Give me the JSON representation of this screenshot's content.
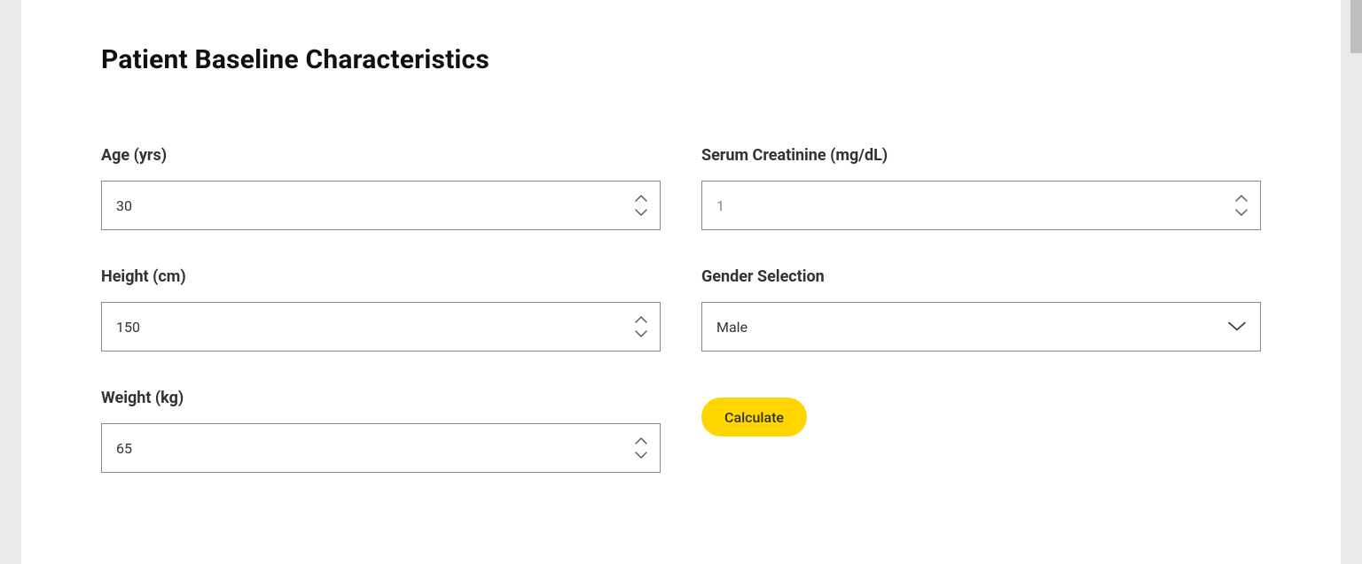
{
  "title": "Patient Baseline Characteristics",
  "form": {
    "age": {
      "label": "Age (yrs)",
      "value": "30"
    },
    "height": {
      "label": "Height (cm)",
      "value": "150"
    },
    "weight": {
      "label": "Weight (kg)",
      "value": "65"
    },
    "serum_creatinine": {
      "label": "Serum Creatinine (mg/dL)",
      "value": "1"
    },
    "gender": {
      "label": "Gender Selection",
      "value": "Male"
    }
  },
  "buttons": {
    "calculate": "Calculate"
  }
}
